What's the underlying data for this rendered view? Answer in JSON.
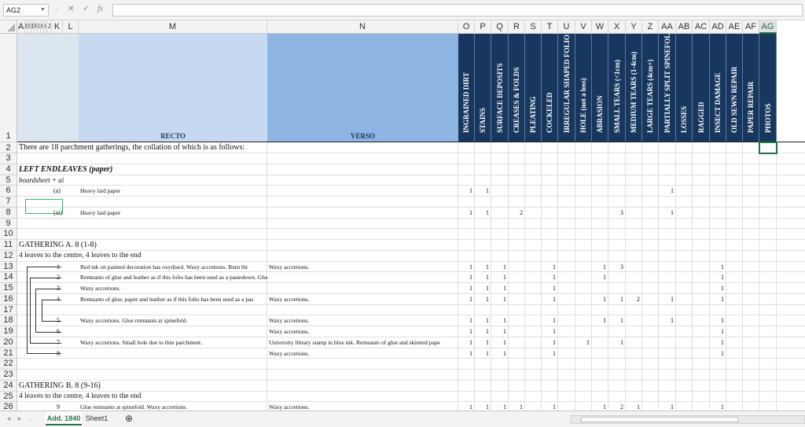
{
  "formula_bar": {
    "name_box": "AG2",
    "formula": "",
    "fx_label": "fx",
    "cancel_label": "✕",
    "enter_label": "✓"
  },
  "columns": [
    {
      "label": "A"
    },
    {
      "label": "B"
    },
    {
      "label": "C"
    },
    {
      "label": "E"
    },
    {
      "label": "F"
    },
    {
      "label": "G"
    },
    {
      "label": "H"
    },
    {
      "label": "I"
    },
    {
      "label": "J"
    },
    {
      "label": "K"
    },
    {
      "label": "L"
    },
    {
      "label": "M"
    },
    {
      "label": "N"
    },
    {
      "label": "O"
    },
    {
      "label": "P"
    },
    {
      "label": "Q"
    },
    {
      "label": "R"
    },
    {
      "label": "S"
    },
    {
      "label": "T"
    },
    {
      "label": "U"
    },
    {
      "label": "V"
    },
    {
      "label": "W"
    },
    {
      "label": "X"
    },
    {
      "label": "Y"
    },
    {
      "label": "Z"
    },
    {
      "label": "AA"
    },
    {
      "label": "AB"
    },
    {
      "label": "AC"
    },
    {
      "label": "AD"
    },
    {
      "label": "AE"
    },
    {
      "label": "AF"
    },
    {
      "label": "AG"
    }
  ],
  "rows": [
    "1",
    "2",
    "3",
    "4",
    "5",
    "6",
    "7",
    "8",
    "9",
    "10",
    "11",
    "12",
    "13",
    "14",
    "15",
    "16",
    "17",
    "18",
    "19",
    "20",
    "21",
    "22",
    "23",
    "24",
    "25",
    "26"
  ],
  "header": {
    "recto": "RECTO",
    "verso": "VERSO",
    "conditions": [
      "INGRAINED DIRT",
      "STAINS",
      "SURFACE DEPOSITS",
      "CREASES & FOLDS",
      "PLEATING",
      "COCKELED",
      "IRREGULAR SHAPED FOLIO",
      "HOLE (not a loss)",
      "ABRASION",
      "SMALL TEARS (<1cm)",
      "MEDIUM TEARS (1-4cm)",
      "LARGE TEARS (4cm+)",
      "PARTIALLY SPLIT SPINEFOLD",
      "LOSSES",
      "RAGGED",
      "INSECT DAMAGE",
      "OLD SEWN REPAIR",
      "PAPER REPAIR",
      "PHOTOS"
    ]
  },
  "intro": "There are 18 parchment gatherings, the collation of which is as follows:",
  "left_endleaves": {
    "title": "LEFT ENDLEAVES (paper)",
    "sub": "boardsheet + ai"
  },
  "gathering_a": {
    "title": "GATHERING A. 8 (1-8)",
    "sub": "4 leaves to the centre, 4 leaves to the end"
  },
  "gathering_b": {
    "title": "GATHERING B. 8 (9-16)",
    "sub": "4 leaves to the centre, 4 leaves to the end"
  },
  "leaves": [
    {
      "row": 6,
      "label": "(a)",
      "recto": "Heavy laid paper",
      "verso": "",
      "marks": {
        "O": "1",
        "P": "1",
        "AA": "1"
      }
    },
    {
      "row": 8,
      "label": "(ai)",
      "recto": "Heavy laid paper",
      "verso": "",
      "marks": {
        "O": "1",
        "P": "1",
        "R": "2",
        "X": "3",
        "AA": "1"
      }
    },
    {
      "row": 13,
      "label": "1",
      "recto": "Red ink on painted decoration has oxydised. Waxy accretions.  Burn thr",
      "verso": "Waxy accretions.",
      "marks": {
        "O": "1",
        "P": "1",
        "Q": "1",
        "T": "1",
        "W": "1",
        "X": "3",
        "AD": "1"
      }
    },
    {
      "row": 14,
      "label": "2",
      "recto": "Remnants of glue and leather as if this folio has been used as a pastedown.  Glue remnants at spinefold.",
      "verso": "",
      "marks": {
        "O": "1",
        "P": "1",
        "Q": "1",
        "T": "1",
        "W": "1",
        "AD": "1"
      }
    },
    {
      "row": 15,
      "label": "3",
      "recto": "Waxy accretions.",
      "verso": "",
      "marks": {
        "O": "1",
        "P": "1",
        "Q": "1",
        "T": "1",
        "AD": "1"
      }
    },
    {
      "row": 16,
      "label": "4",
      "recto": "Remnants of glue, paper and leather as if this folio has been used as a pas",
      "verso": "Waxy accretions.",
      "marks": {
        "O": "1",
        "P": "1",
        "Q": "1",
        "T": "1",
        "W": "1",
        "X": "1",
        "Y": "2",
        "AA": "1",
        "AD": "1"
      }
    },
    {
      "row": 18,
      "label": "5",
      "recto": "Waxy accretions.  Glue remnants at spinefold.",
      "verso": "Waxy accretions.",
      "marks": {
        "O": "1",
        "P": "1",
        "Q": "1",
        "T": "1",
        "W": "1",
        "X": "1",
        "AA": "1",
        "AD": "1"
      }
    },
    {
      "row": 19,
      "label": "6",
      "recto": "",
      "verso": "Waxy accretions.",
      "marks": {
        "O": "1",
        "P": "1",
        "Q": "1",
        "T": "1",
        "AD": "1"
      }
    },
    {
      "row": 20,
      "label": "7",
      "recto": "Waxy accretions.  Small hole due to thin parchment.",
      "verso": "University library stamp in blue ink.  Remnants of glue and skinned pape",
      "marks": {
        "O": "1",
        "P": "1",
        "Q": "1",
        "T": "1",
        "V": "1",
        "X": "1",
        "AD": "1"
      }
    },
    {
      "row": 21,
      "label": "8",
      "recto": "",
      "verso": "Waxy accretions.",
      "marks": {
        "O": "1",
        "P": "1",
        "Q": "1",
        "T": "1",
        "AD": "1"
      }
    },
    {
      "row": 26,
      "label": "9",
      "recto": "Glue remnants at spinefold.  Waxy accretions.",
      "verso": "Waxy accretions.",
      "marks": {
        "O": "1",
        "P": "1",
        "Q": "1",
        "R": "1",
        "T": "1",
        "W": "1",
        "X": "2",
        "Y": "1",
        "AA": "1",
        "AD": "1"
      }
    }
  ],
  "sheets": [
    {
      "name": "Add. 1840",
      "active": true
    },
    {
      "name": "Sheet1",
      "active": false
    }
  ],
  "add_sheet": "⊕",
  "colors": {
    "recto_band": "#c5d9f1",
    "verso_band": "#8db4e2",
    "condition_header": "#17375e",
    "left_band": "#dce6f1",
    "accent": "#217346"
  }
}
